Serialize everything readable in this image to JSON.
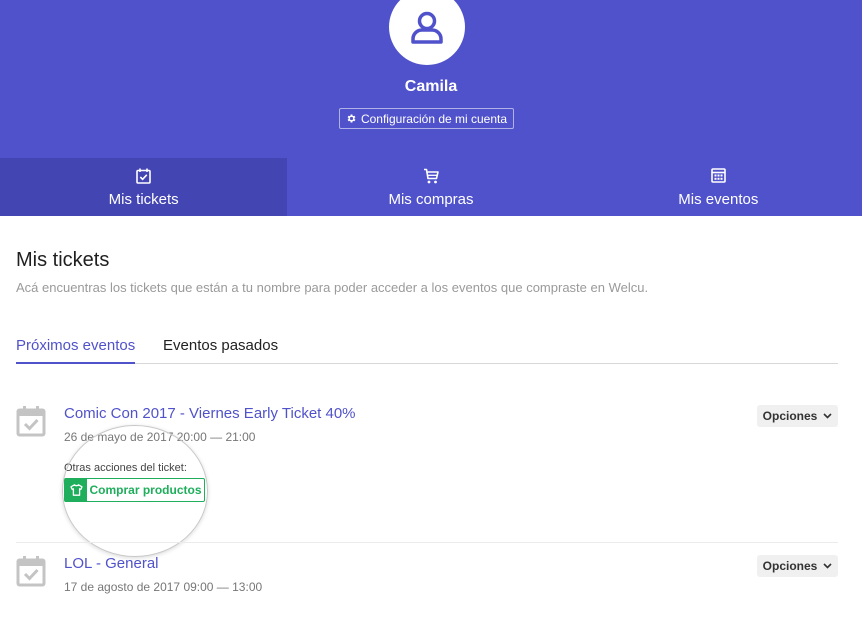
{
  "header": {
    "username": "Camila",
    "account_settings_label": "Configuración de mi cuenta"
  },
  "nav": {
    "tabs": [
      {
        "label": "Mis tickets",
        "icon": "calendar-check-icon",
        "active": true
      },
      {
        "label": "Mis compras",
        "icon": "cart-icon",
        "active": false
      },
      {
        "label": "Mis eventos",
        "icon": "calendar-icon",
        "active": false
      }
    ]
  },
  "main": {
    "title": "Mis tickets",
    "description": "Acá encuentras los tickets que están a tu nombre para poder acceder a los eventos que compraste en Welcu.",
    "tabs": [
      {
        "label": "Próximos eventos",
        "active": true
      },
      {
        "label": "Eventos pasados",
        "active": false
      }
    ],
    "tickets": [
      {
        "name": "Comic Con 2017 - Viernes Early Ticket 40%",
        "date": "26 de mayo de 2017 20:00 — 21:00",
        "options_label": "Opciones",
        "other_actions_label": "Otras acciones del ticket:",
        "buy_products_label": "Comprar productos"
      },
      {
        "name": "LOL - General",
        "date": "17 de agosto de 2017 09:00 — 13:00",
        "options_label": "Opciones"
      }
    ]
  },
  "colors": {
    "brand": "#5052cb",
    "brand_dark": "#4345b2",
    "success": "#1fae5b"
  }
}
